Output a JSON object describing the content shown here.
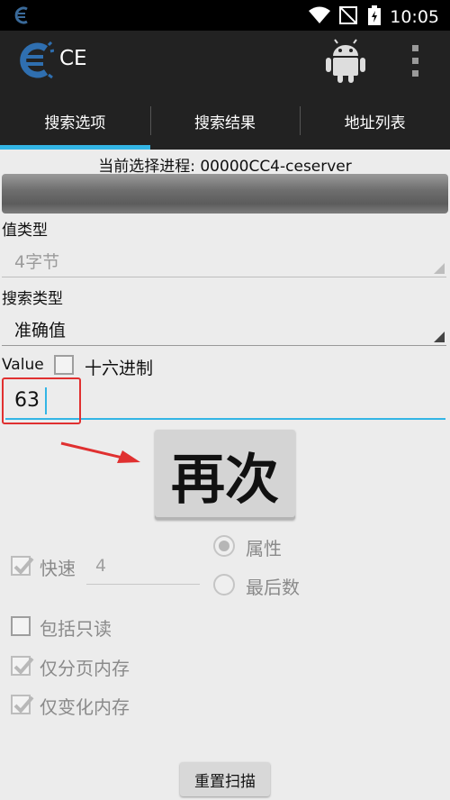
{
  "status_bar": {
    "time": "10:05",
    "icons": [
      "ce-notification-icon",
      "wifi-icon",
      "no-signal-icon",
      "battery-icon"
    ]
  },
  "app": {
    "title": "CE",
    "icons": [
      "ce-logo-icon",
      "android-icon",
      "overflow-menu-icon"
    ]
  },
  "tabs": [
    {
      "label": "搜索选项",
      "active": true
    },
    {
      "label": "搜索结果",
      "active": false
    },
    {
      "label": "地址列表",
      "active": false
    }
  ],
  "process": {
    "label": "当前选择进程: 00000CC4-ceserver"
  },
  "value_type": {
    "label": "值类型",
    "selected": "4字节"
  },
  "scan_type": {
    "label": "搜索类型",
    "selected": "准确值"
  },
  "value": {
    "label": "Value",
    "hex_label": "十六进制",
    "hex_checked": false,
    "input_value": "63"
  },
  "again_button": {
    "label": "再次"
  },
  "fast_scan": {
    "label": "快速",
    "checked": true,
    "value": "4"
  },
  "alignment": {
    "option_attr": "属性",
    "option_last": "最后数",
    "selected": "属性"
  },
  "options": {
    "readonly_label": "包括只读",
    "readonly_checked": false,
    "paged_label": "仅分页内存",
    "paged_checked": true,
    "changed_label": "仅变化内存",
    "changed_checked": true
  },
  "reset_button": {
    "label": "重置扫描"
  },
  "colors": {
    "accent": "#33b5e5",
    "action_bar": "#222222",
    "annotation": "#e03030"
  }
}
